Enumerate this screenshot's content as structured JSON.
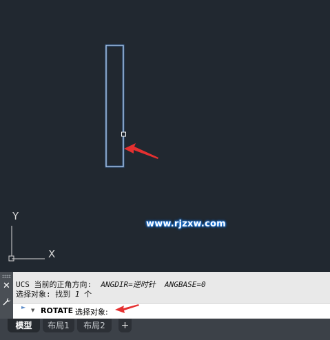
{
  "canvas": {
    "watermark": "www.rjzxw.com",
    "ucs_axis_y": "Y",
    "ucs_axis_x": "X"
  },
  "command_panel": {
    "history_line1_prefix": "UCS 当前的正角方向:  ",
    "history_angdir": "ANGDIR=逆时针  ANGBASE=0",
    "history_line2_prefix": "选择对象: 找到 ",
    "history_line2_count": "1",
    "history_line2_suffix": " 个",
    "command_name": "ROTATE",
    "command_prompt": "选择对象:",
    "close_icon_label": "✕"
  },
  "tabs": [
    {
      "label": "模型",
      "active": true
    },
    {
      "label": "布局1",
      "active": false
    },
    {
      "label": "布局2",
      "active": false
    },
    {
      "label": "+",
      "active": false
    }
  ],
  "colors": {
    "canvas_bg": "#212830",
    "selection_outline": "#4f8fd8",
    "arrow": "#e53030",
    "watermark_glow": "#1e88ff"
  }
}
